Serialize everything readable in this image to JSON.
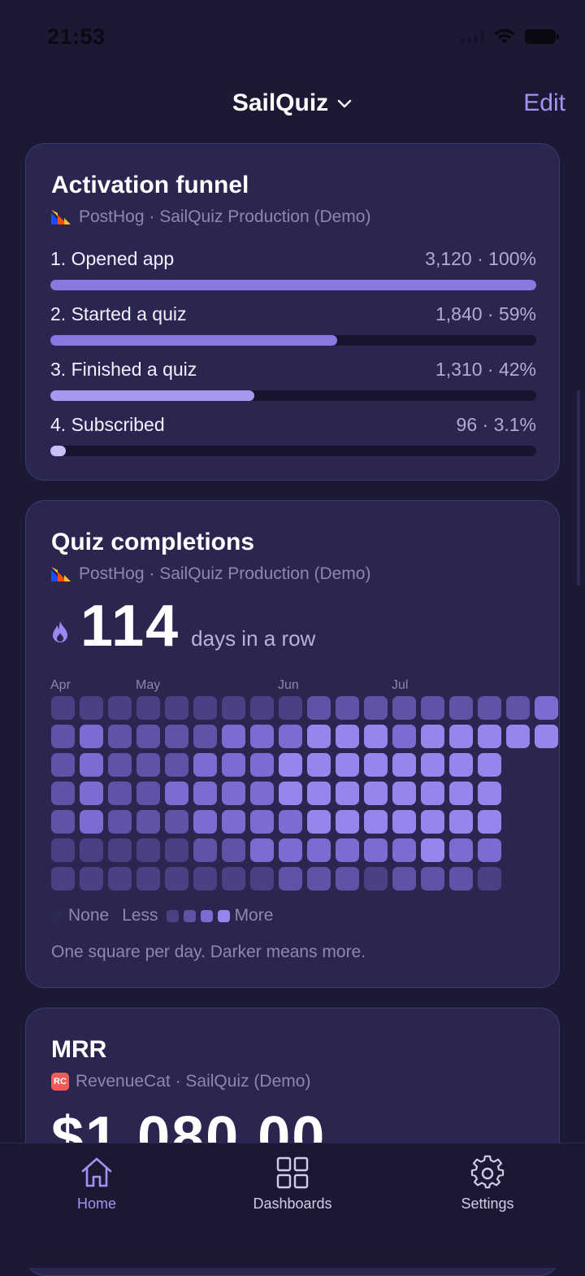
{
  "status_bar": {
    "time": "21:53"
  },
  "header": {
    "app_name": "SailQuiz",
    "edit_label": "Edit"
  },
  "colors": {
    "accent": "#a592f2",
    "background": "#1b1934",
    "card": "#2a2650",
    "track": "#17152e"
  },
  "funnel": {
    "title": "Activation funnel",
    "source": "PostHog · SailQuiz Production (Demo)",
    "steps": [
      {
        "label": "1. Opened app",
        "value": "3,120 · 100%",
        "fraction": 1.0,
        "color": "#8a77df"
      },
      {
        "label": "2. Started a quiz",
        "value": "1,840 · 59%",
        "fraction": 0.59,
        "color": "#8a77df"
      },
      {
        "label": "3. Finished a quiz",
        "value": "1,310 · 42%",
        "fraction": 0.42,
        "color": "#a897ee"
      },
      {
        "label": "4. Subscribed",
        "value": "96 · 3.1%",
        "fraction": 0.031,
        "color": "#cbbff8"
      }
    ]
  },
  "completions": {
    "title": "Quiz completions",
    "source": "PostHog · SailQuiz Production (Demo)",
    "streak_number": "114",
    "streak_unit": "days in a row",
    "months": [
      {
        "label": "Apr",
        "col": 0
      },
      {
        "label": "May",
        "col": 3
      },
      {
        "label": "Jun",
        "col": 8
      },
      {
        "label": "Jul",
        "col": 12
      }
    ],
    "heatmap_levels": [
      [
        1,
        1,
        1,
        1,
        1,
        1,
        1,
        1,
        1,
        2,
        2,
        2,
        2,
        2,
        2,
        2,
        2,
        3
      ],
      [
        2,
        3,
        2,
        2,
        2,
        2,
        3,
        3,
        3,
        4,
        4,
        4,
        3,
        4,
        4,
        4,
        4,
        4
      ],
      [
        2,
        3,
        2,
        2,
        2,
        3,
        3,
        3,
        4,
        4,
        4,
        4,
        4,
        4,
        4,
        4
      ],
      [
        2,
        3,
        2,
        2,
        3,
        3,
        3,
        3,
        4,
        4,
        4,
        4,
        4,
        4,
        4,
        4
      ],
      [
        2,
        3,
        2,
        2,
        2,
        3,
        3,
        3,
        3,
        4,
        4,
        4,
        4,
        4,
        4,
        4
      ],
      [
        1,
        1,
        1,
        1,
        1,
        2,
        2,
        3,
        3,
        3,
        3,
        3,
        3,
        4,
        3,
        3
      ],
      [
        1,
        1,
        1,
        1,
        1,
        1,
        1,
        1,
        2,
        2,
        2,
        1,
        2,
        2,
        2,
        1
      ]
    ],
    "level_colors": [
      "#2c2854",
      "#4a4185",
      "#5e53a6",
      "#7a6cd0",
      "#9685ec"
    ],
    "legend": {
      "none": "None",
      "less": "Less",
      "more": "More"
    },
    "caption": "One square per day. Darker means more."
  },
  "mrr": {
    "title": "MRR",
    "source": "RevenueCat · SailQuiz (Demo)",
    "value": "$1,080.00",
    "logo_text": "RC"
  },
  "tabs": [
    {
      "label": "Home",
      "icon": "home-icon",
      "active": true
    },
    {
      "label": "Dashboards",
      "icon": "grid-icon",
      "active": false
    },
    {
      "label": "Settings",
      "icon": "gear-icon",
      "active": false
    }
  ]
}
